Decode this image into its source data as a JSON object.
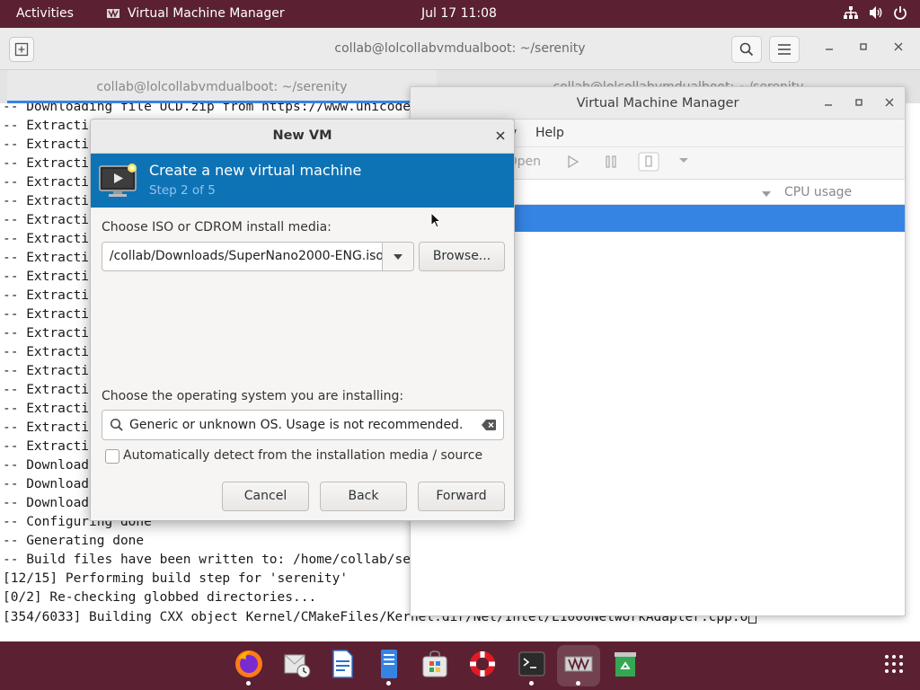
{
  "topbar": {
    "activities": "Activities",
    "app_name": "Virtual Machine Manager",
    "clock": "Jul 17  11:08"
  },
  "terminal": {
    "title": "collab@lolcollabvmdualboot: ~/serenity",
    "tabs": [
      {
        "label": "collab@lolcollabvmdualboot: ~/serenity"
      },
      {
        "label": "collab@lolcollabvmdualboot: ~/serenity"
      }
    ],
    "lines": [
      "-- Downloading file UCD.zip from https://www.unicode.org/Public/14.0.0/ucd/UCD.zip",
      "-- Extracting",
      "-- Extracting",
      "-- Extracting",
      "-- Extracting",
      "-- Extracting",
      "-- Extracting",
      "-- Extracting",
      "-- Extracting",
      "-- Extracting",
      "-- Extracting",
      "-- Extracting",
      "-- Extracting",
      "-- Extracting",
      "-- Extracting",
      "-- Extracting",
      "-- Extracting",
      "-- Extracting",
      "-- Extracting",
      "-- Download",
      "-- Download",
      "-- Download",
      "-- Configuring done",
      "-- Generating done",
      "-- Build files have been written to: /home/collab/serenity/Build/i686",
      "[12/15] Performing build step for 'serenity'",
      "[0/2] Re-checking globbed directories...",
      "[354/6033] Building CXX object Kernel/CMakeFiles/Kernel.dir/Net/Intel/E1000NetworkAdapter.cpp.o"
    ]
  },
  "vmm": {
    "title": "Virtual Machine Manager",
    "menu": {
      "view": "v",
      "help": "Help"
    },
    "toolbar": {
      "open": "Open"
    },
    "columns": {
      "cpu_usage": "CPU usage"
    }
  },
  "dialog": {
    "title": "New VM",
    "heading": "Create a new virtual machine",
    "step": "Step 2 of 5",
    "iso_label": "Choose ISO or CDROM install media:",
    "iso_value": "/home/collab/Downloads/SuperNano2000-ENG.iso",
    "browse": "Browse...",
    "os_label": "Choose the operating system you are installing:",
    "os_value": "Generic or unknown OS. Usage is not recommended.",
    "auto_detect": "Automatically detect from the installation media / source",
    "auto_detect_checked": false,
    "cancel": "Cancel",
    "back": "Back",
    "forward": "Forward"
  },
  "dock": {
    "items": [
      "firefox-icon",
      "evolution-icon",
      "writer-icon",
      "documents-icon",
      "software-icon",
      "help-icon",
      "terminal-icon",
      "virt-manager-icon",
      "trash-icon"
    ],
    "accent": "#5b2133"
  },
  "colors": {
    "topbar": "#5b2133",
    "banner": "#0e73b5",
    "selection": "#3584e4"
  }
}
